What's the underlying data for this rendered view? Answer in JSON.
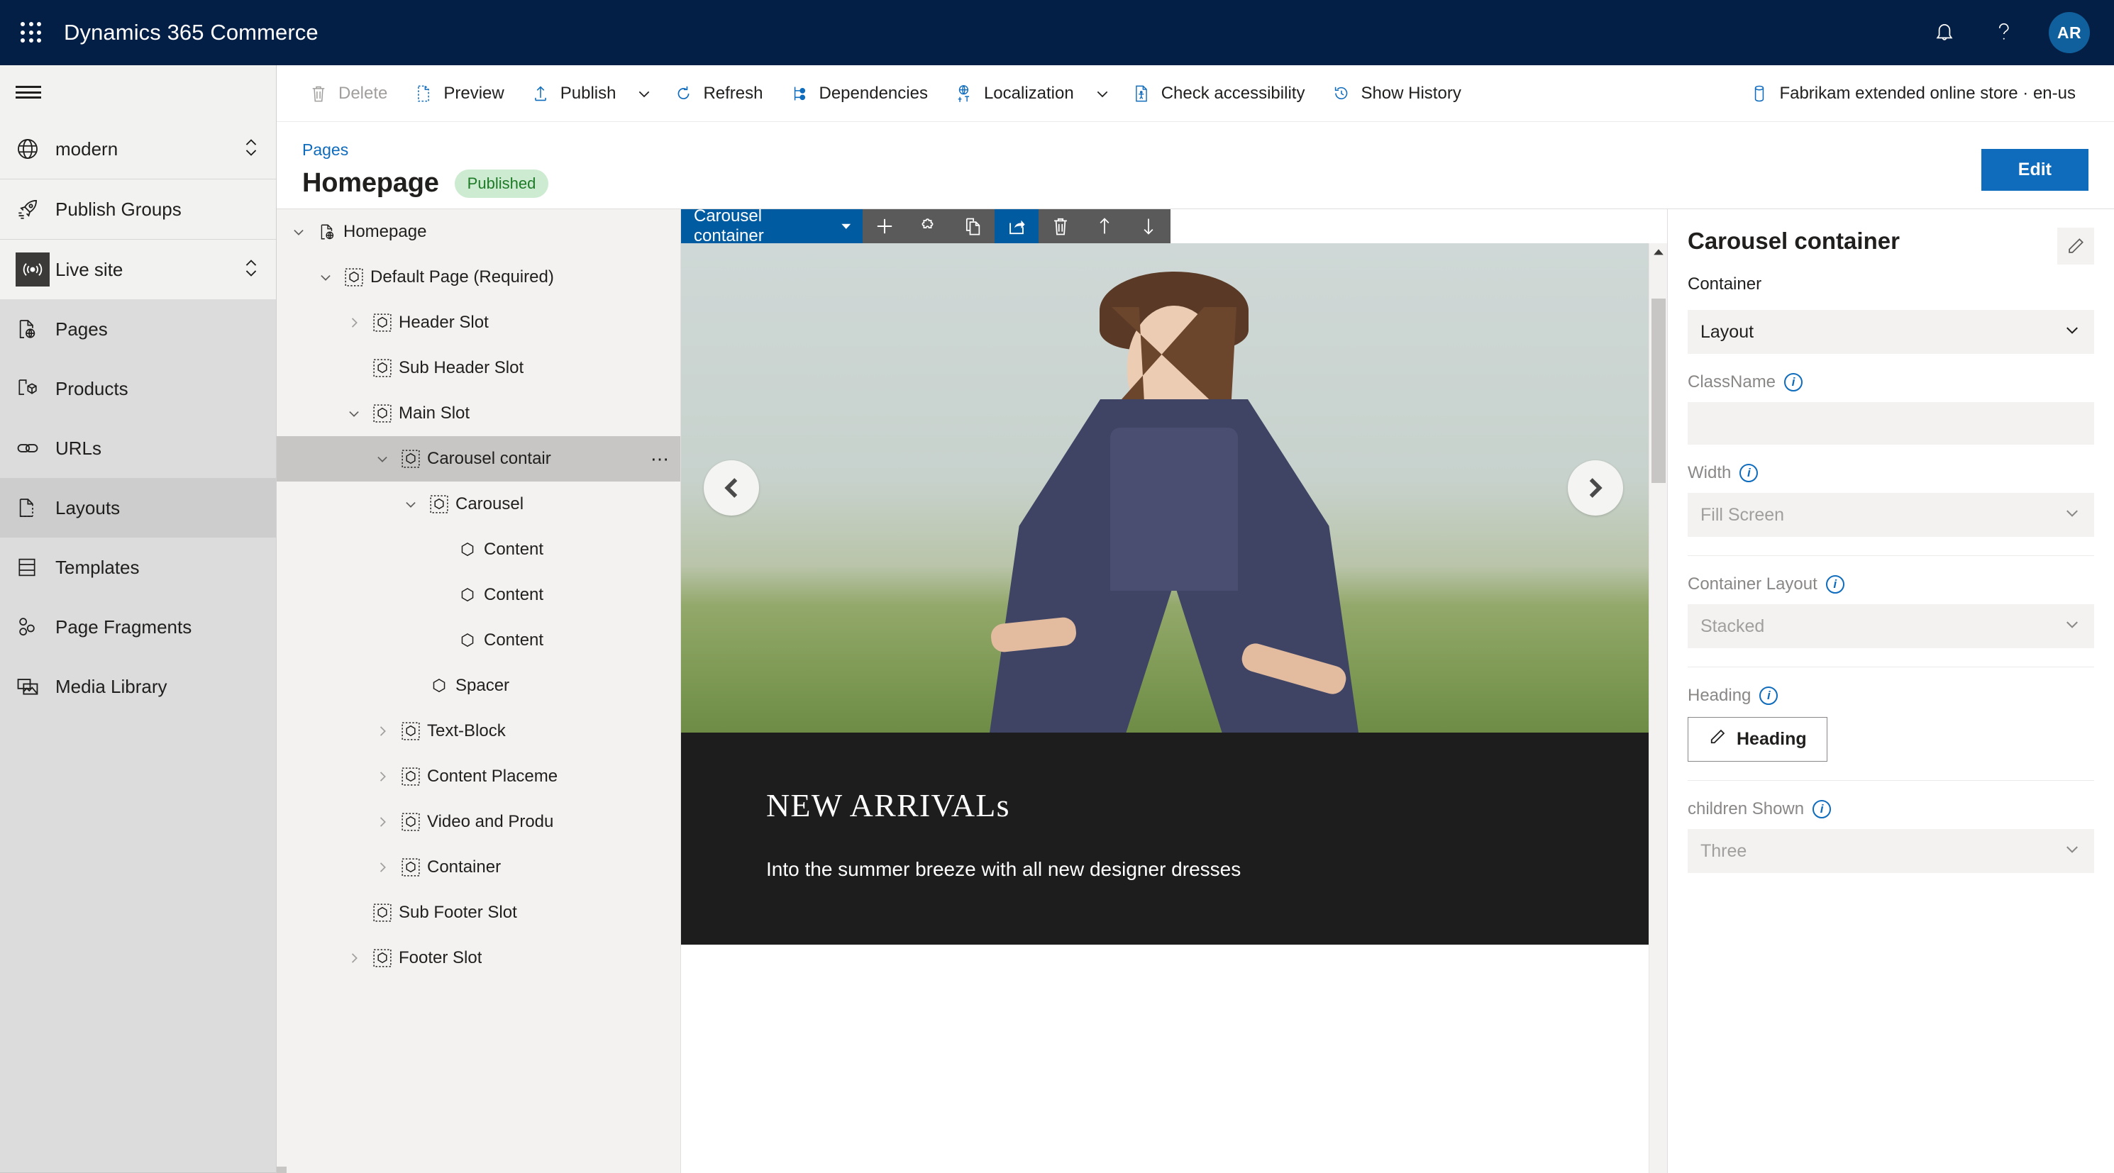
{
  "topbar": {
    "app_title": "Dynamics 365 Commerce",
    "waffle_name": "app-launcher",
    "notifications_icon": "bell-icon",
    "help_icon": "question-mark-icon",
    "avatar_initials": "AR",
    "brand_color": "#041f45",
    "avatar_color": "#10609e"
  },
  "rail": {
    "menu_icon": "hamburger-icon",
    "site": {
      "label": "modern",
      "icon": "globe-icon"
    },
    "items": [
      {
        "label": "Publish Groups",
        "icon": "rocket-icon",
        "active": false,
        "expandable": false
      },
      {
        "label": "Live site",
        "icon": "broadcast-icon",
        "active": false,
        "expandable": true
      },
      {
        "label": "Pages",
        "icon": "page-globe-icon",
        "active": false,
        "expandable": false
      },
      {
        "label": "Products",
        "icon": "product-box-icon",
        "active": false,
        "expandable": false
      },
      {
        "label": "URLs",
        "icon": "link-icon",
        "active": false,
        "expandable": false
      },
      {
        "label": "Layouts",
        "icon": "layout-page-icon",
        "active": true,
        "expandable": false
      },
      {
        "label": "Templates",
        "icon": "template-icon",
        "active": false,
        "expandable": false
      },
      {
        "label": "Page Fragments",
        "icon": "fragments-icon",
        "active": false,
        "expandable": false
      },
      {
        "label": "Media Library",
        "icon": "media-image-icon",
        "active": false,
        "expandable": false
      }
    ]
  },
  "commandbar": {
    "items": [
      {
        "label": "Delete",
        "icon": "trash-icon",
        "disabled": true,
        "chevron": false
      },
      {
        "label": "Preview",
        "icon": "preview-page-icon",
        "disabled": false,
        "chevron": false
      },
      {
        "label": "Publish",
        "icon": "publish-upload-icon",
        "disabled": false,
        "chevron": true
      },
      {
        "label": "Refresh",
        "icon": "refresh-icon",
        "disabled": false,
        "chevron": false
      },
      {
        "label": "Dependencies",
        "icon": "dependencies-icon",
        "disabled": false,
        "chevron": false
      },
      {
        "label": "Localization",
        "icon": "localization-globe-icon",
        "disabled": false,
        "chevron": true
      },
      {
        "label": "Check accessibility",
        "icon": "accessibility-icon",
        "disabled": false,
        "chevron": false
      },
      {
        "label": "Show History",
        "icon": "history-clock-icon",
        "disabled": false,
        "chevron": false
      }
    ],
    "channel": {
      "label": "Fabrikam extended online store · en-us",
      "icon": "database-icon"
    }
  },
  "page": {
    "breadcrumb": "Pages",
    "title": "Homepage",
    "status_badge": "Published",
    "status_badge_bg": "#ccebd0",
    "status_badge_color": "#1d7a26",
    "edit_button": "Edit",
    "edit_button_color": "#0f6cbd"
  },
  "tree": {
    "nodes": [
      {
        "label": "Homepage",
        "indent": 0,
        "twisty": "down",
        "icon": "page-globe-icon",
        "selected": false,
        "menu": false
      },
      {
        "label": "Default Page (Required)",
        "indent": 1,
        "twisty": "down",
        "icon": "module-icon",
        "selected": false,
        "menu": false
      },
      {
        "label": "Header Slot",
        "indent": 2,
        "twisty": "right",
        "icon": "module-icon",
        "selected": false,
        "menu": false
      },
      {
        "label": "Sub Header Slot",
        "indent": 2,
        "twisty": "none",
        "icon": "module-icon",
        "selected": false,
        "menu": false
      },
      {
        "label": "Main Slot",
        "indent": 2,
        "twisty": "down",
        "icon": "module-icon",
        "selected": false,
        "menu": false
      },
      {
        "label": "Carousel contair",
        "indent": 3,
        "twisty": "down",
        "icon": "module-icon",
        "selected": true,
        "menu": true
      },
      {
        "label": "Carousel",
        "indent": 4,
        "twisty": "down",
        "icon": "module-icon",
        "selected": false,
        "menu": false
      },
      {
        "label": "Content",
        "indent": 5,
        "twisty": "none",
        "icon": "hex-icon",
        "selected": false,
        "menu": false
      },
      {
        "label": "Content",
        "indent": 5,
        "twisty": "none",
        "icon": "hex-icon",
        "selected": false,
        "menu": false
      },
      {
        "label": "Content",
        "indent": 5,
        "twisty": "none",
        "icon": "hex-icon",
        "selected": false,
        "menu": false
      },
      {
        "label": "Spacer",
        "indent": 4,
        "twisty": "none",
        "icon": "hex-icon",
        "selected": false,
        "menu": false
      },
      {
        "label": "Text-Block",
        "indent": 3,
        "twisty": "right",
        "icon": "module-icon",
        "selected": false,
        "menu": false
      },
      {
        "label": "Content Placeme",
        "indent": 3,
        "twisty": "right",
        "icon": "module-icon",
        "selected": false,
        "menu": false
      },
      {
        "label": "Video and Produ",
        "indent": 3,
        "twisty": "right",
        "icon": "module-icon",
        "selected": false,
        "menu": false
      },
      {
        "label": "Container",
        "indent": 3,
        "twisty": "right",
        "icon": "module-icon",
        "selected": false,
        "menu": false
      },
      {
        "label": "Sub Footer Slot",
        "indent": 2,
        "twisty": "none",
        "icon": "module-icon",
        "selected": false,
        "menu": false
      },
      {
        "label": "Footer Slot",
        "indent": 2,
        "twisty": "right",
        "icon": "module-icon",
        "selected": false,
        "menu": false
      }
    ]
  },
  "canvas": {
    "module_toolbar": {
      "name": "Carousel container",
      "buttons": [
        {
          "icon": "add-plus-icon",
          "active": false
        },
        {
          "icon": "module-puzzle-icon",
          "active": false
        },
        {
          "icon": "copy-icon",
          "active": false
        },
        {
          "icon": "share-export-icon",
          "active": true
        },
        {
          "icon": "trash-icon",
          "active": false
        },
        {
          "icon": "move-up-icon",
          "active": false
        },
        {
          "icon": "move-down-icon",
          "active": false
        }
      ],
      "active_color": "#005ba1",
      "bar_color": "#5a5a5a"
    },
    "carousel": {
      "prev_icon": "chevron-left-icon",
      "next_icon": "chevron-right-icon",
      "caption_title": "NEW ARRIVALs",
      "caption_subtitle": "Into the summer breeze with all new designer dresses",
      "caption_bg": "#1d1d1d"
    }
  },
  "props": {
    "title": "Carousel container",
    "edit_icon": "pencil-icon",
    "subtitle": "Container",
    "layout_select": "Layout",
    "fields": [
      {
        "label": "ClassName",
        "kind": "input",
        "value": "",
        "info": true
      },
      {
        "label": "Width",
        "kind": "select",
        "value": "Fill Screen",
        "info": true
      },
      {
        "label": "Container Layout",
        "kind": "select",
        "value": "Stacked",
        "info": true
      }
    ],
    "heading_label": "Heading",
    "heading_button": "Heading",
    "heading_button_icon": "pencil-icon",
    "children_label": "children Shown",
    "children_value": "Three"
  }
}
